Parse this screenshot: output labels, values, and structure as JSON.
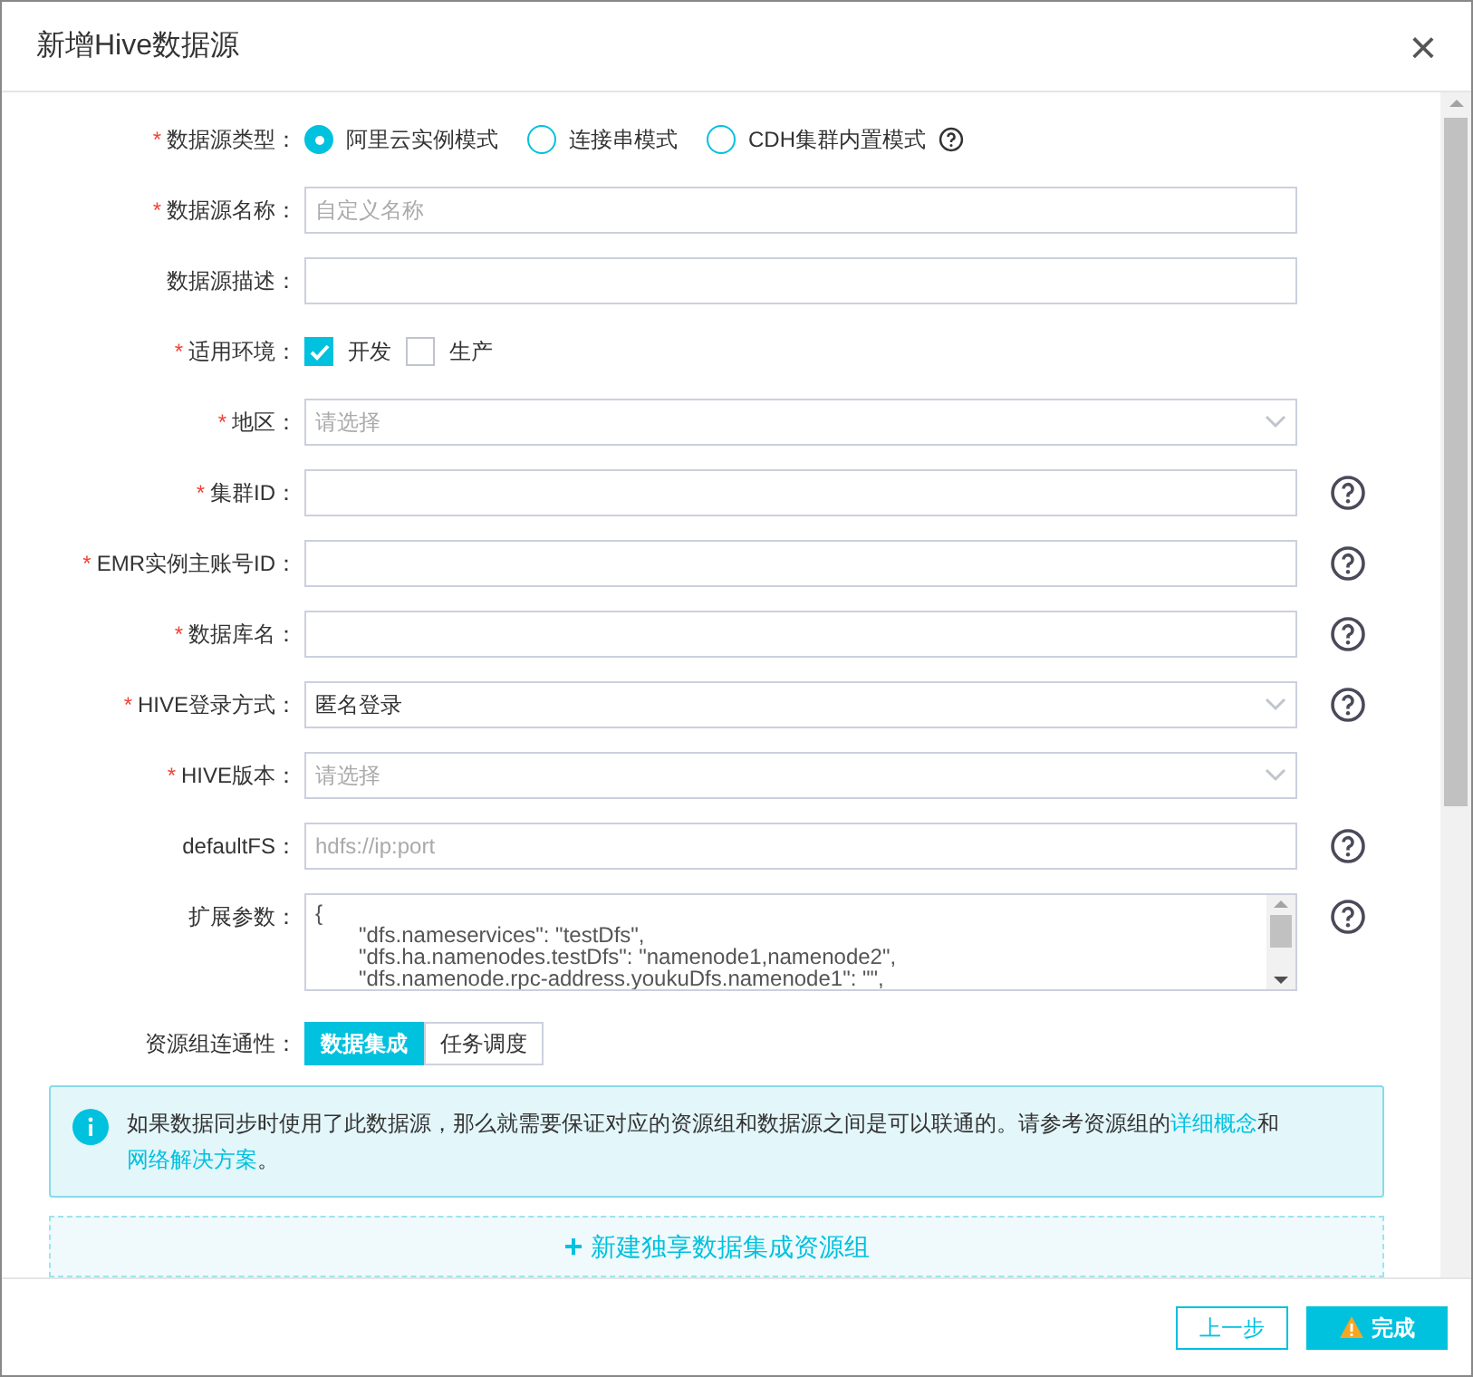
{
  "dialog": {
    "title": "新增Hive数据源",
    "close": "×"
  },
  "required_mark": "*",
  "fields": [
    {
      "kind": "radio",
      "label": "数据源类型：",
      "required": true,
      "options": [
        {
          "label": "阿里云实例模式",
          "selected": true
        },
        {
          "label": "连接串模式",
          "selected": false
        },
        {
          "label": "CDH集群内置模式",
          "selected": false,
          "help": true
        }
      ]
    },
    {
      "kind": "input",
      "label": "数据源名称：",
      "required": true,
      "placeholder": "自定义名称",
      "help": false
    },
    {
      "kind": "input",
      "label": "数据源描述：",
      "required": false,
      "help": false
    },
    {
      "kind": "checkbox",
      "label": "适用环境：",
      "required": true,
      "options": [
        {
          "label": "开发",
          "checked": true
        },
        {
          "label": "生产",
          "checked": false
        }
      ]
    },
    {
      "kind": "select",
      "label": "地区：",
      "required": true,
      "placeholder": "请选择",
      "help": false
    },
    {
      "kind": "input",
      "label": "集群ID：",
      "required": true,
      "help": true
    },
    {
      "kind": "input",
      "label": "EMR实例主账号ID：",
      "required": true,
      "help": true
    },
    {
      "kind": "input",
      "label": "数据库名：",
      "required": true,
      "help": true
    },
    {
      "kind": "select",
      "label": "HIVE登录方式：",
      "required": true,
      "value": "匿名登录",
      "help": true
    },
    {
      "kind": "select",
      "label": "HIVE版本：",
      "required": true,
      "placeholder": "请选择",
      "help": false
    },
    {
      "kind": "input",
      "label": "defaultFS：",
      "required": false,
      "placeholder": "hdfs://ip:port",
      "help": true
    },
    {
      "kind": "textarea",
      "label": "扩展参数：",
      "required": false,
      "help": true,
      "lines": [
        "{",
        "\"dfs.nameservices\": \"testDfs\",",
        "\"dfs.ha.namenodes.testDfs\": \"namenode1,namenode2\",",
        "\"dfs.namenode.rpc-address.youkuDfs.namenode1\": \"\","
      ]
    },
    {
      "kind": "segmented",
      "label": "资源组连通性：",
      "required": false,
      "options": [
        {
          "label": "数据集成",
          "selected": true
        },
        {
          "label": "任务调度",
          "selected": false
        }
      ]
    }
  ],
  "notice": {
    "text": "如果数据同步时使用了此数据源，那么就需要保证对应的资源组和数据源之间是可以联通的。请参考资源组的",
    "link1": "详细概念",
    "middle": "和",
    "link2": "网络解决方案",
    "end": "。"
  },
  "add_group": {
    "icon": "+",
    "label": "新建独享数据集成资源组"
  },
  "footer": {
    "buttons": [
      {
        "label": "上一步",
        "kind": "secondary"
      },
      {
        "label": "完成",
        "kind": "primary",
        "warning": true
      }
    ]
  }
}
